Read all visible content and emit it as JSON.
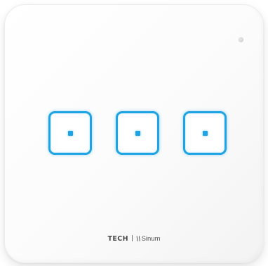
{
  "device": {
    "type": "smart wall switch",
    "panel_color": "#ffffff",
    "accent_color": "#1ea3e4",
    "status_led": {
      "icon": "status-led-icon",
      "color": "#d2d2d2"
    },
    "buttons": [
      {
        "icon": "touch-dot-icon"
      },
      {
        "icon": "touch-dot-icon"
      },
      {
        "icon": "touch-dot-icon"
      }
    ],
    "branding": {
      "brand": "TECH",
      "separator": "|",
      "sub_brand_mark": "\\\\",
      "sub_brand": "Sinum"
    }
  }
}
